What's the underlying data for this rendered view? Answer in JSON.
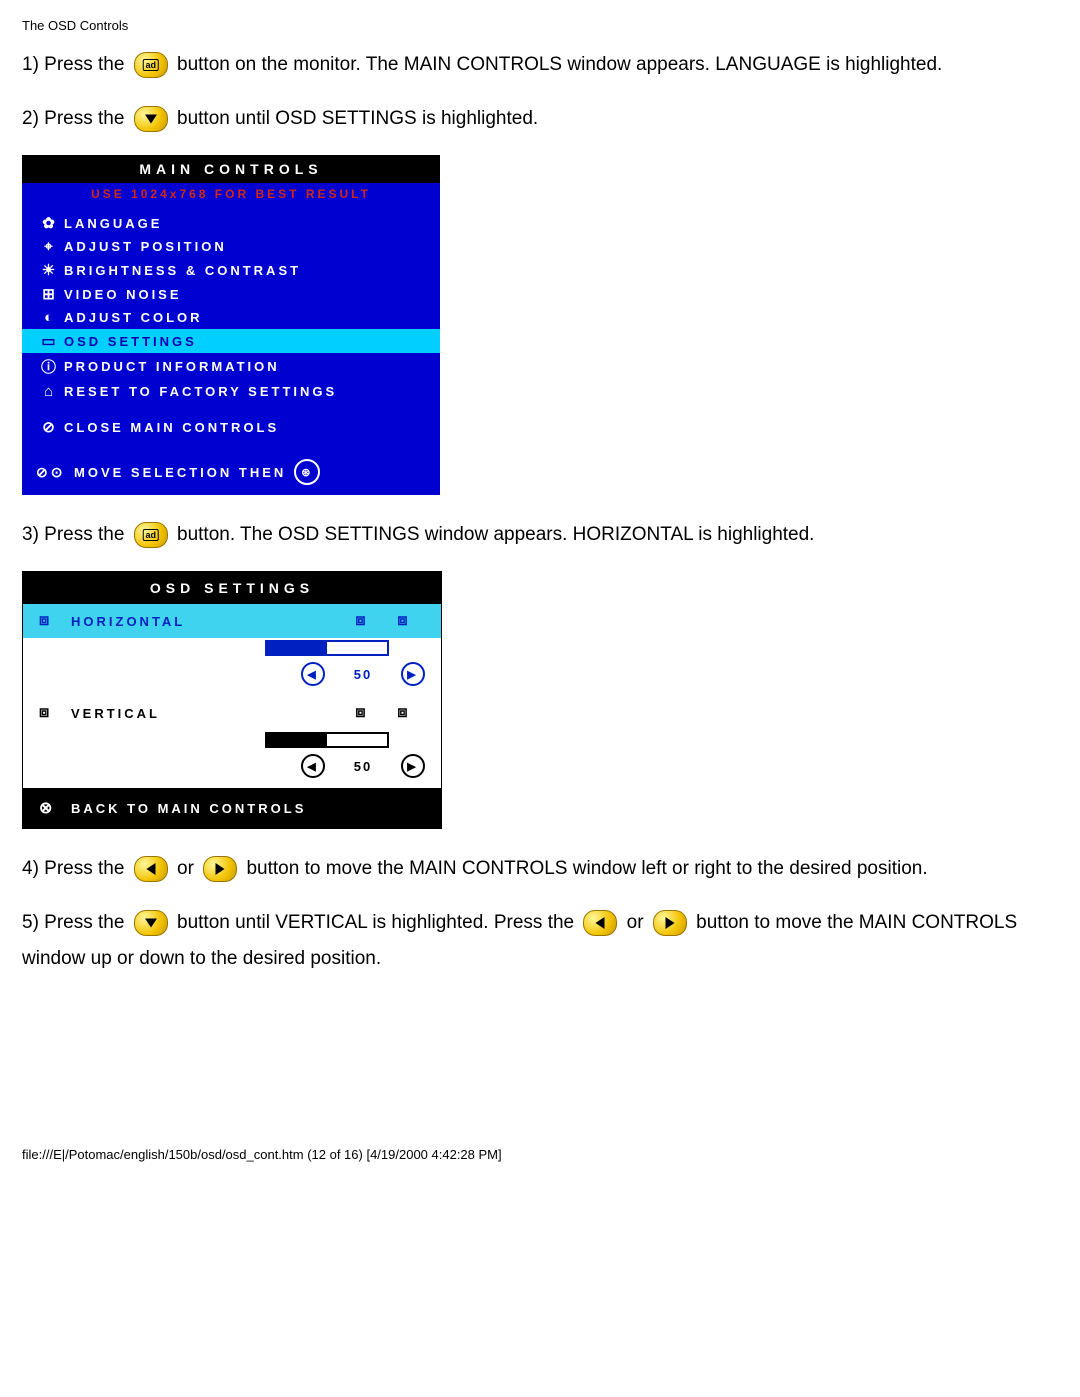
{
  "header": "The OSD Controls",
  "steps": {
    "s1a": "1) Press the ",
    "s1b": " button on the monitor. The MAIN CONTROLS window appears. LANGUAGE is highlighted.",
    "s2a": "2) Press the ",
    "s2b": " button until OSD SETTINGS is highlighted.",
    "s3a": "3) Press the ",
    "s3b": " button. The OSD SETTINGS window appears. HORIZONTAL is highlighted.",
    "s4a": "4) Press the ",
    "s4b": " or ",
    "s4c": " button to move the MAIN CONTROLS window left or right to the desired position.",
    "s5a": "5) Press the ",
    "s5b": " button until VERTICAL is highlighted. Press the ",
    "s5c": " or ",
    "s5d": " button to move the MAIN CONTROLS window up or down to the desired position."
  },
  "main_controls": {
    "title": "MAIN CONTROLS",
    "hint": "USE 1024x768 FOR BEST RESULT",
    "items": [
      {
        "icon": "✿",
        "label": "LANGUAGE"
      },
      {
        "icon": "⌖",
        "label": "ADJUST POSITION"
      },
      {
        "icon": "☀",
        "label": "BRIGHTNESS & CONTRAST"
      },
      {
        "icon": "⊞",
        "label": "VIDEO NOISE"
      },
      {
        "icon": "◐",
        "label": "ADJUST COLOR"
      },
      {
        "icon": "▭",
        "label": "OSD SETTINGS"
      },
      {
        "icon": "ⓘ",
        "label": "PRODUCT INFORMATION"
      },
      {
        "icon": "⌂",
        "label": "RESET TO FACTORY SETTINGS"
      }
    ],
    "close": {
      "icon": "⊘",
      "label": "CLOSE MAIN CONTROLS"
    },
    "move": {
      "icons": "⊘⊙",
      "label": "MOVE SELECTION THEN",
      "end_icon": "⊛"
    },
    "highlighted_index": 5
  },
  "osd_settings": {
    "title": "OSD SETTINGS",
    "rows": [
      {
        "icon": "⧈",
        "label": "HORIZONTAL",
        "value": 50,
        "hl": true,
        "eic1": "⧈",
        "eic2": "⧈"
      },
      {
        "icon": "⧈",
        "label": "VERTICAL",
        "value": 50,
        "hl": false,
        "eic1": "⧈",
        "eic2": "⧈"
      }
    ],
    "back": {
      "icon": "⊗",
      "label": "BACK TO MAIN CONTROLS"
    }
  },
  "footer": "file:///E|/Potomac/english/150b/osd/osd_cont.htm (12 of 16) [4/19/2000 4:42:28 PM]"
}
